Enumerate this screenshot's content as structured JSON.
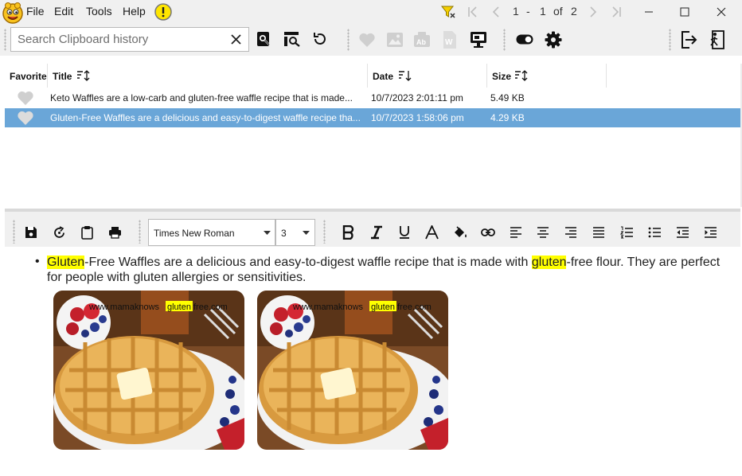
{
  "menu": {
    "file": "File",
    "edit": "Edit",
    "tools": "Tools",
    "help": "Help"
  },
  "pager": {
    "current_start": "1",
    "separator": "-",
    "current_end": "1",
    "of": "of",
    "total": "2"
  },
  "search": {
    "placeholder": "Search Clipboard history",
    "value": ""
  },
  "columns": {
    "favorite": "Favorite",
    "title": "Title",
    "date": "Date",
    "size": "Size"
  },
  "rows": [
    {
      "title": "Keto Waffles are a low-carb and gluten-free waffle recipe that is made...",
      "date": "10/7/2023 2:01:11 pm",
      "size": "5.49 KB",
      "selected": false
    },
    {
      "title": "Gluten-Free Waffles are a delicious and easy-to-digest waffle recipe tha...",
      "date": "10/7/2023 1:58:06 pm",
      "size": "4.29 KB",
      "selected": true
    }
  ],
  "editor": {
    "font_name": "Times New Roman",
    "font_size": "3",
    "text_hl1": "Gluten",
    "text_part1": "-Free Waffles are a delicious and easy-to-digest waffle recipe that is made with ",
    "text_hl2": "gluten",
    "text_part2": "-free flour. They are perfect for people with gluten allergies or sensitivities.",
    "watermark_pre": "www.mamaknowsglutenfree.com"
  },
  "colors": {
    "accent": "#6aa6d8",
    "highlight": "#ffff00",
    "filter_icon": "#f5d000",
    "logo": "#f9c31e"
  },
  "icons": [
    "app-logo-icon",
    "alert-icon",
    "filter-icon",
    "first-page-icon",
    "prev-page-icon",
    "next-page-icon",
    "last-page-icon",
    "minimize-icon",
    "maximize-icon",
    "close-icon",
    "clear-search-icon",
    "search-icon",
    "advanced-search-icon",
    "refresh-icon",
    "favorite-icon",
    "image-icon",
    "text-icon",
    "word-icon",
    "screen-icon",
    "toggle-icon",
    "gear-icon",
    "logout-icon",
    "exit-icon"
  ]
}
